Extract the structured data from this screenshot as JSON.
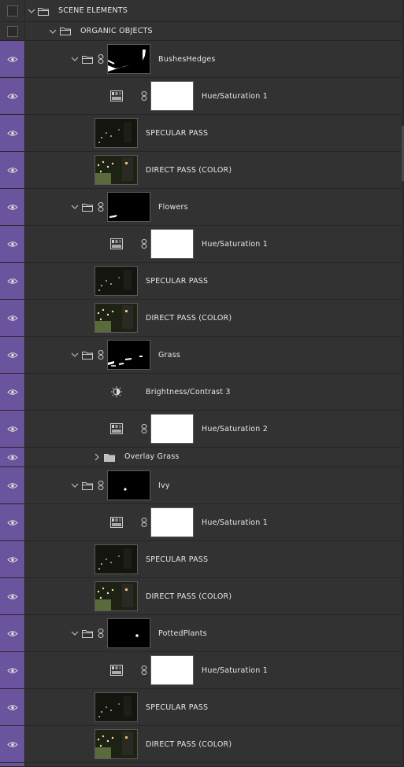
{
  "layers": [
    {
      "name": "SCENE ELEMENTS"
    },
    {
      "name": "ORGANIC OBJECTS"
    },
    {
      "name": "BushesHedges"
    },
    {
      "name": "Hue/Saturation 1"
    },
    {
      "name": "SPECULAR PASS"
    },
    {
      "name": "DIRECT PASS (COLOR)"
    },
    {
      "name": "Flowers"
    },
    {
      "name": "Hue/Saturation 1"
    },
    {
      "name": "SPECULAR PASS"
    },
    {
      "name": "DIRECT PASS (COLOR)"
    },
    {
      "name": "Grass"
    },
    {
      "name": "Brightness/Contrast 3"
    },
    {
      "name": "Hue/Saturation 2"
    },
    {
      "name": "Overlay Grass"
    },
    {
      "name": "Ivy"
    },
    {
      "name": "Hue/Saturation 1"
    },
    {
      "name": "SPECULAR PASS"
    },
    {
      "name": "DIRECT PASS (COLOR)"
    },
    {
      "name": "PottedPlants"
    },
    {
      "name": "Hue/Saturation 1"
    },
    {
      "name": "SPECULAR PASS"
    },
    {
      "name": "DIRECT PASS (COLOR)"
    }
  ],
  "colors": {
    "visibility_column": "#6a549d",
    "panel_bg": "#323232",
    "text": "#e6e6e6"
  },
  "icons": {
    "visibility": "eye-icon",
    "group": "folder-icon",
    "expanded": "chevron-down-icon",
    "collapsed": "chevron-right-icon",
    "mask_link": "link-icon",
    "hue_saturation": "hue-saturation-icon",
    "brightness_contrast": "brightness-contrast-icon"
  }
}
